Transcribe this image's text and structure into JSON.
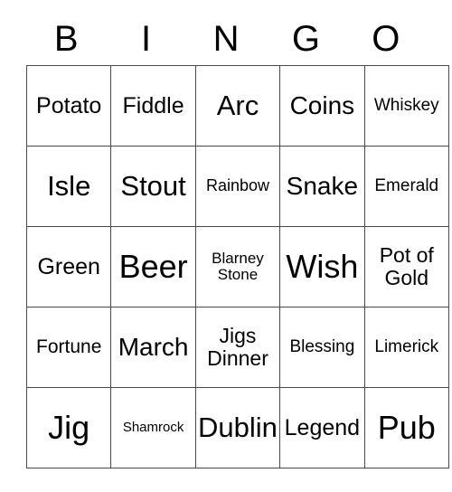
{
  "card": {
    "title_letters": [
      "B",
      "I",
      "N",
      "G",
      "O"
    ],
    "columns": 5,
    "rows": 5,
    "grid": [
      [
        {
          "text": "Potato",
          "size": "fs-xl"
        },
        {
          "text": "Fiddle",
          "size": "fs-xl"
        },
        {
          "text": "Arc",
          "size": "fs-huge"
        },
        {
          "text": "Coins",
          "size": "fs-xxl"
        },
        {
          "text": "Whiskey",
          "size": "fs-m"
        }
      ],
      [
        {
          "text": "Isle",
          "size": "fs-huge"
        },
        {
          "text": "Stout",
          "size": "fs-huge"
        },
        {
          "text": "Rainbow",
          "size": "fs-sm"
        },
        {
          "text": "Snake",
          "size": "fs-xxl"
        },
        {
          "text": "Emerald",
          "size": "fs-m"
        }
      ],
      [
        {
          "text": "Green",
          "size": "fs-xl"
        },
        {
          "text": "Beer",
          "size": "fs-max"
        },
        {
          "text": "Blarney\nStone",
          "size": "fs-s"
        },
        {
          "text": "Wish",
          "size": "fs-max"
        },
        {
          "text": "Pot of\nGold",
          "size": "fs-l"
        }
      ],
      [
        {
          "text": "Fortune",
          "size": "fs-ml"
        },
        {
          "text": "March",
          "size": "fs-xxl"
        },
        {
          "text": "Jigs\nDinner",
          "size": "fs-l"
        },
        {
          "text": "Blessing",
          "size": "fs-m"
        },
        {
          "text": "Limerick",
          "size": "fs-m"
        }
      ],
      [
        {
          "text": "Jig",
          "size": "fs-max"
        },
        {
          "text": "Shamrock",
          "size": "fs-xs"
        },
        {
          "text": "Dublin",
          "size": "fs-huge"
        },
        {
          "text": "Legend",
          "size": "fs-xl"
        },
        {
          "text": "Pub",
          "size": "fs-max"
        }
      ]
    ]
  },
  "colors": {
    "background": "#ffffff",
    "text": "#000000",
    "grid_line": "#4a4a4a"
  }
}
